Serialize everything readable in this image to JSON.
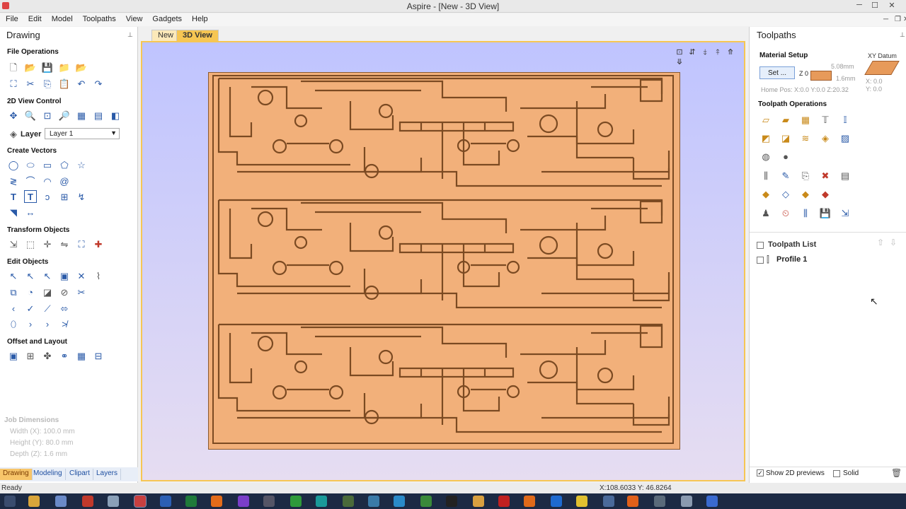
{
  "window": {
    "title": "Aspire - [New - 3D View]",
    "min": "─",
    "max": "☐",
    "close": "✕"
  },
  "menu": [
    "File",
    "Edit",
    "Model",
    "Toolpaths",
    "View",
    "Gadgets",
    "Help"
  ],
  "drawing_panel": {
    "title": "Drawing",
    "pin": "⊥",
    "sections": {
      "file_ops": "File Operations",
      "view2d": "2D View Control",
      "create_vectors": "Create Vectors",
      "transform": "Transform Objects",
      "edit": "Edit Objects",
      "offset": "Offset and Layout"
    },
    "layer_label": "Layer",
    "layer_value": "Layer 1",
    "job_dimensions": {
      "title": "Job Dimensions",
      "width": "Width  (X): 100.0 mm",
      "height": "Height (Y): 80.0 mm",
      "depth": "Depth  (Z): 1.6 mm"
    },
    "tabs": [
      "Drawing",
      "Modeling",
      "Clipart",
      "Layers"
    ]
  },
  "view_tabs": [
    "New",
    "3D View"
  ],
  "toolpaths_panel": {
    "title": "Toolpaths",
    "pin": "⊥",
    "material_setup": "Material Setup",
    "set_button": "Set ...",
    "z0": "Z 0",
    "thickness_top": "5.08mm",
    "thickness": "1.6mm",
    "xy_datum": "XY Datum",
    "datum_x": "X: 0.0",
    "datum_y": "Y: 0.0",
    "home_pos": "Home Pos:  X:0.0 Y:0.0 Z:20.32",
    "toolpath_operations": "Toolpath Operations",
    "toolpath_list": "Toolpath List",
    "profile_item": "Profile 1",
    "show_2d": "Show 2D previews",
    "solid": "Solid"
  },
  "status": {
    "left": "Ready",
    "coords": "X:108.6033 Y: 46.8264"
  }
}
